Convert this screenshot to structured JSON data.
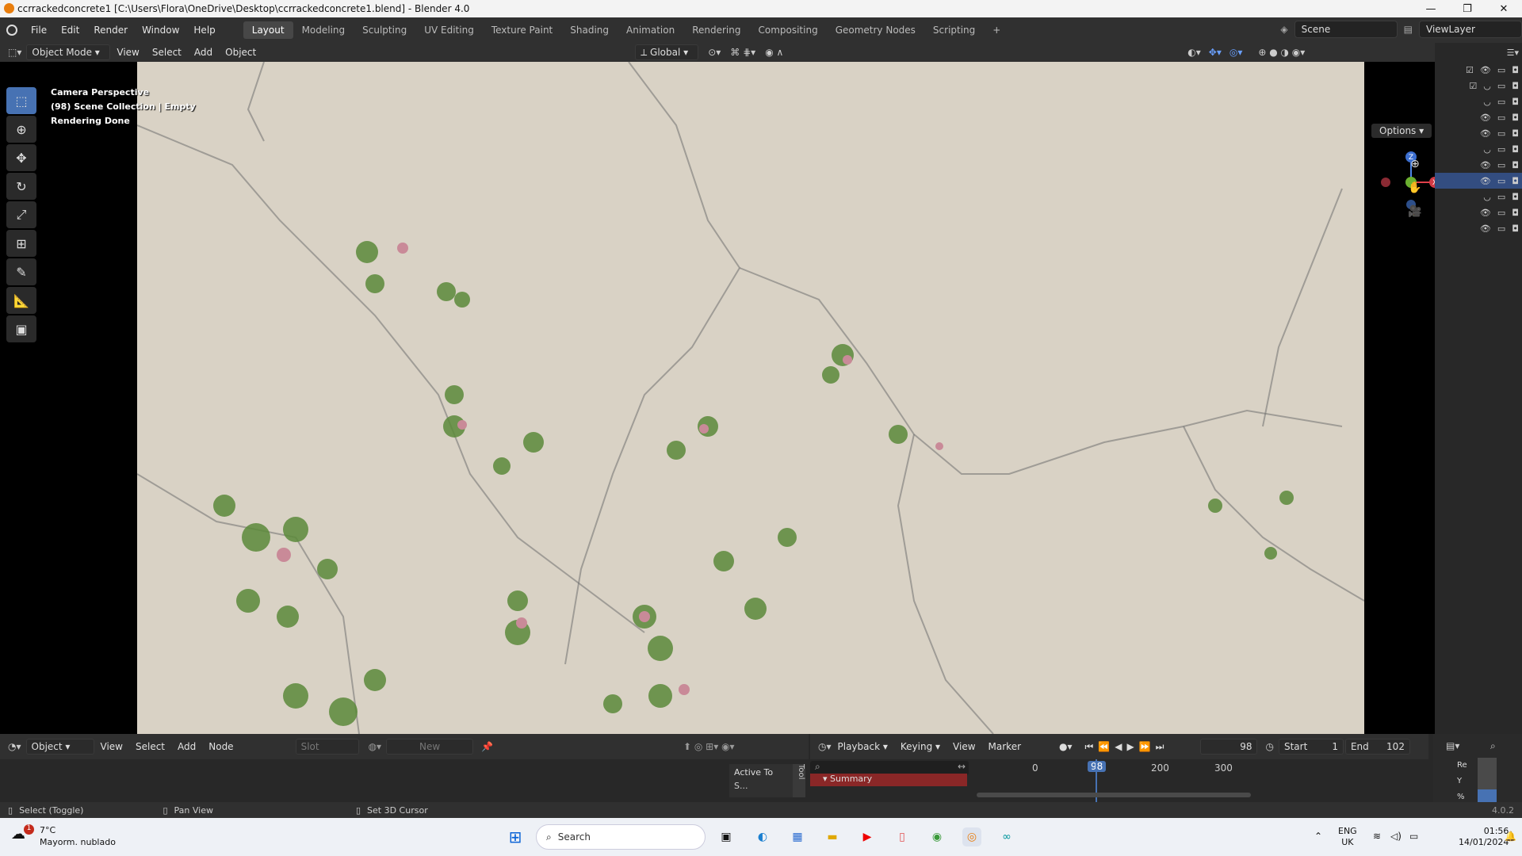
{
  "window": {
    "title": "ccrrackedconcrete1 [C:\\Users\\Flora\\OneDrive\\Desktop\\ccrrackedconcrete1.blend] - Blender 4.0",
    "controls": [
      "—",
      "❐",
      "✕"
    ]
  },
  "menubar": {
    "menus": [
      "File",
      "Edit",
      "Render",
      "Window",
      "Help"
    ],
    "workspaces": [
      "Layout",
      "Modeling",
      "Sculpting",
      "UV Editing",
      "Texture Paint",
      "Shading",
      "Animation",
      "Rendering",
      "Compositing",
      "Geometry Nodes",
      "Scripting"
    ],
    "active_workspace": "Layout",
    "add_tab": "+",
    "scene": "Scene",
    "view_layer": "ViewLayer"
  },
  "viewport_header": {
    "mode": "Object Mode",
    "menus": [
      "View",
      "Select",
      "Add",
      "Object"
    ],
    "transform_orientation": "Global",
    "options": "Options"
  },
  "viewport": {
    "overlay_lines": [
      "Camera Perspective",
      "(98) Scene Collection | Empty",
      "Rendering Done"
    ],
    "gizmo_axes": {
      "z": "Z",
      "x": "X",
      "y": "Y"
    }
  },
  "node_editor_header": {
    "type": "Object",
    "menus": [
      "View",
      "Select",
      "Add",
      "Node"
    ],
    "slot": "Slot",
    "new_label": "New",
    "active_tool": "Active To",
    "tool_tab": "Tool",
    "sidebar_s": "S..."
  },
  "timeline": {
    "menus": [
      "Playback",
      "Keying",
      "View",
      "Marker"
    ],
    "current_frame": "98",
    "start_label": "Start",
    "start": "1",
    "end_label": "End",
    "end": "102",
    "ruler": [
      "0",
      "98",
      "200",
      "300"
    ],
    "summary": "Summary"
  },
  "properties_mini": [
    "Re",
    "Y",
    "%"
  ],
  "status_bar": {
    "hints": [
      "Select (Toggle)",
      "Pan View",
      "Set 3D Cursor"
    ],
    "version": "4.0.2"
  },
  "taskbar": {
    "weather_temp": "7°C",
    "weather_desc": "Mayorm. nublado",
    "weather_badge": "1",
    "search": "Search",
    "lang1": "ENG",
    "lang2": "UK",
    "time": "01:56",
    "date": "14/01/2024"
  },
  "colors": {
    "accent": "#4772b3",
    "bg": "#303030",
    "summary": "#8a2727"
  }
}
